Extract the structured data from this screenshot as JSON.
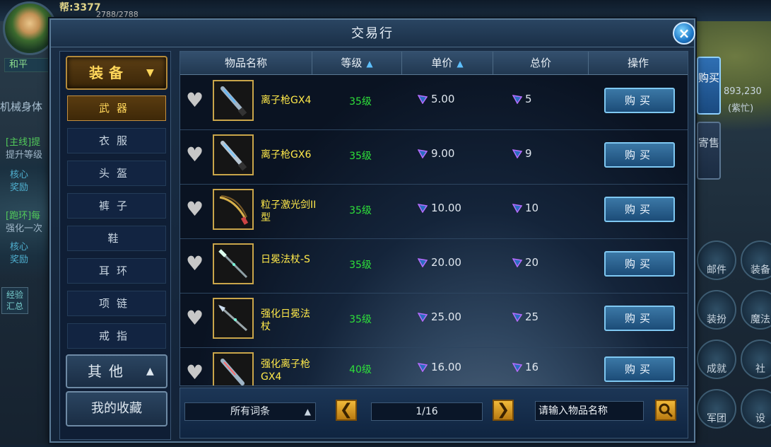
{
  "hud": {
    "top_number": "帮:3377",
    "hp": "2788/2788",
    "peace_mode": "和平",
    "left_texts": [
      "机械身体",
      "[主线]提",
      "提升等级",
      "核心",
      "奖励",
      "[跑环]每",
      "强化一次",
      "核心",
      "奖励",
      "经验",
      "汇总"
    ],
    "right_texts": [
      "893,230",
      "(紫忙)",
      "邮件",
      "装扮",
      "成就",
      "军团",
      "魔法",
      "装备",
      "社",
      "设"
    ]
  },
  "dialog": {
    "title": "交易行",
    "close_icon": "close-icon"
  },
  "categories": {
    "main_header": "装备",
    "items": [
      {
        "label": "武器",
        "active": true
      },
      {
        "label": "衣服",
        "active": false
      },
      {
        "label": "头盔",
        "active": false
      },
      {
        "label": "裤子",
        "active": false
      },
      {
        "label": "鞋",
        "active": false
      },
      {
        "label": "耳环",
        "active": false
      },
      {
        "label": "项链",
        "active": false
      },
      {
        "label": "戒指",
        "active": false
      }
    ],
    "other_header": "其他",
    "favorites": "我的收藏"
  },
  "table": {
    "headers": {
      "name": "物品名称",
      "level": "等级",
      "unit_price": "单价",
      "total_price": "总价",
      "action": "操作"
    },
    "rows": [
      {
        "name": "离子枪GX4",
        "level": "35级",
        "unit_price": "5.00",
        "total_price": "5",
        "buy": "购买"
      },
      {
        "name": "离子枪GX6",
        "level": "35级",
        "unit_price": "9.00",
        "total_price": "9",
        "buy": "购买"
      },
      {
        "name": "粒子激光剑II型",
        "level": "35级",
        "unit_price": "10.00",
        "total_price": "10",
        "buy": "购买"
      },
      {
        "name": "日冕法杖-S",
        "level": "35级",
        "unit_price": "20.00",
        "total_price": "20",
        "buy": "购买"
      },
      {
        "name": "强化日冕法杖",
        "level": "35级",
        "unit_price": "25.00",
        "total_price": "25",
        "buy": "购买"
      },
      {
        "name": "强化离子枪GX4",
        "level": "40级",
        "unit_price": "16.00",
        "total_price": "16",
        "buy": "购买"
      }
    ]
  },
  "footer": {
    "filter": "所有词条",
    "page": "1/16",
    "search_placeholder": "请输入物品名称"
  },
  "side_tabs": {
    "buy": "购买",
    "sell": "寄售"
  },
  "colors": {
    "item_name": "#ffe94a",
    "level": "#2ee03a",
    "accent_gold": "#c9a54a",
    "buy_button": "#1c4c78"
  }
}
